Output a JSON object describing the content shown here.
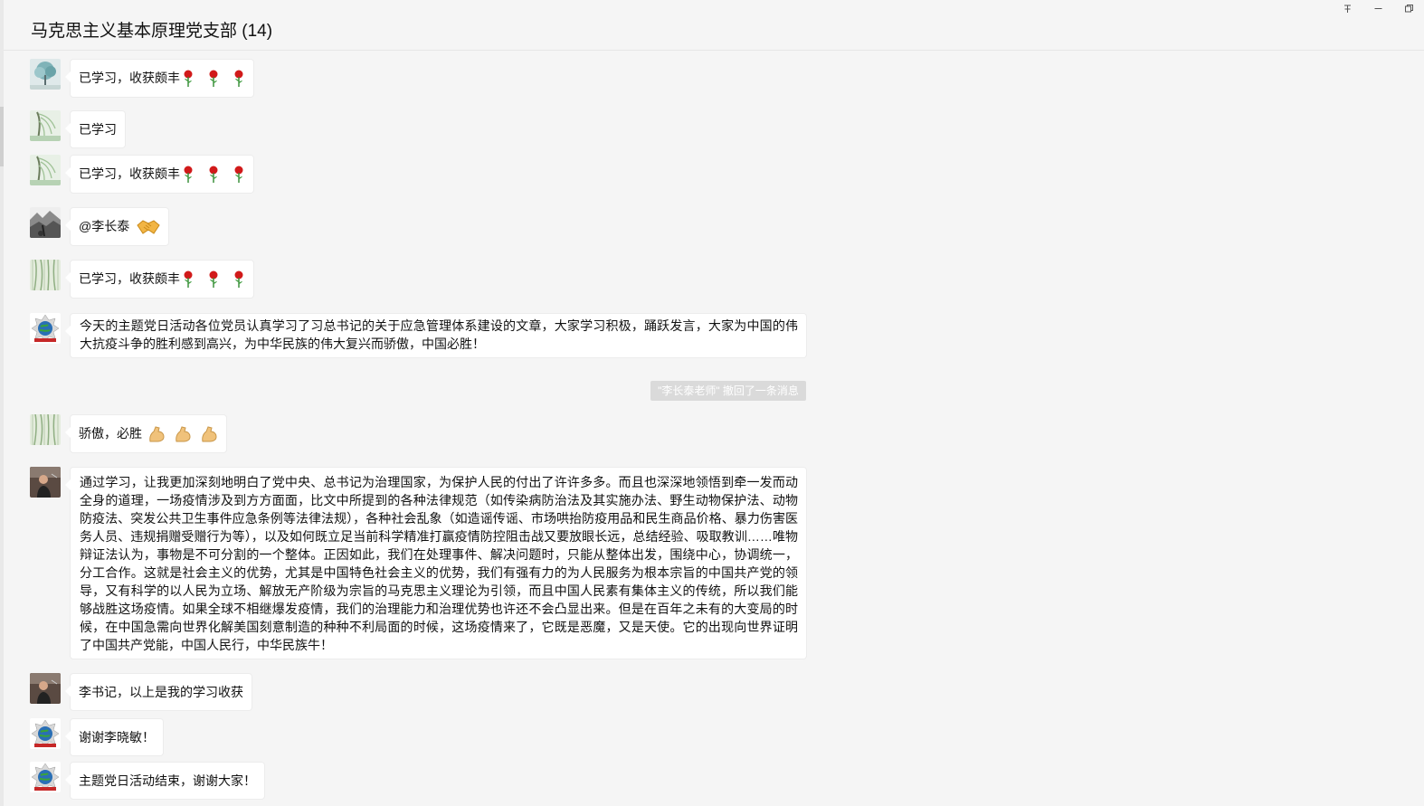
{
  "window": {
    "title": "马克思主义基本原理党支部 (14)",
    "controls": [
      "pin-icon",
      "minimize-icon",
      "restore-icon"
    ]
  },
  "messages": [
    {
      "text": "已学习，收获颇丰",
      "emoji": [
        "rose-icon",
        "rose-icon",
        "rose-icon"
      ],
      "avatar": "avatar-tree"
    },
    {
      "text": "已学习",
      "emoji": [],
      "avatar": "avatar-willow"
    },
    {
      "text": "已学习，收获颇丰",
      "emoji": [
        "rose-icon",
        "rose-icon",
        "rose-icon"
      ],
      "avatar": "avatar-willow"
    },
    {
      "text": "@李长泰",
      "emoji": [
        "handshake-icon"
      ],
      "avatar": "avatar-ink-landscape"
    },
    {
      "text": "已学习，收获颇丰",
      "emoji": [
        "rose-icon",
        "rose-icon",
        "rose-icon"
      ],
      "avatar": "avatar-willow-green"
    },
    {
      "text": "今天的主题党日活动各位党员认真学习了习总书记的关于应急管理体系建设的文章，大家学习积极，踊跃发言，大家为中国的伟大抗疫斗争的胜利感到高兴，为中华民族的伟大复兴而骄傲，中国必胜！",
      "emoji": [],
      "avatar": "avatar-globe-emblem"
    },
    {
      "text": "骄傲，必胜",
      "emoji": [
        "flexed-biceps-icon",
        "flexed-biceps-icon",
        "flexed-biceps-icon"
      ],
      "avatar": "avatar-willow-green"
    },
    {
      "text": "通过学习，让我更加深刻地明白了党中央、总书记为治理国家，为保护人民的付出了许许多多。而且也深深地领悟到牵一发而动全身的道理，一场疫情涉及到方方面面，比文中所提到的各种法律规范（如传染病防治法及其实施办法、野生动物保护法、动物防疫法、突发公共卫生事件应急条例等法律法规），各种社会乱象（如造谣传谣、市场哄抬防疫用品和民生商品价格、暴力伤害医务人员、违规捐赠受赠行为等），以及如何既立足当前科学精准打赢疫情防控阻击战又要放眼长远，总结经验、吸取教训……唯物辩证法认为，事物是不可分割的一个整体。正因如此，我们在处理事件、解决问题时，只能从整体出发，围绕中心，协调统一，分工合作。这就是社会主义的优势，尤其是中国特色社会主义的优势，我们有强有力的为人民服务为根本宗旨的中国共产党的领导，又有科学的以人民为立场、解放无产阶级为宗旨的马克思主义理论为引领，而且中国人民素有集体主义的传统，所以我们能够战胜这场疫情。如果全球不相继爆发疫情，我们的治理能力和治理优势也许还不会凸显出来。但是在百年之未有的大变局的时候，在中国急需向世界化解美国刻意制造的种种不利局面的时候，这场疫情来了，它既是恶魔，又是天使。它的出现向世界证明了中国共产党能，中国人民行，中华民族牛！",
      "emoji": [],
      "avatar": "avatar-person-dark"
    },
    {
      "text": "李书记，以上是我的学习收获",
      "emoji": [],
      "avatar": "avatar-person-dark"
    },
    {
      "text": "谢谢李晓敏！",
      "emoji": [],
      "avatar": "avatar-globe-emblem"
    },
    {
      "text": "主题党日活动结束，谢谢大家！",
      "emoji": [],
      "avatar": "avatar-globe-emblem"
    }
  ],
  "system_notice": "\"李长泰老师\" 撤回了一条消息"
}
